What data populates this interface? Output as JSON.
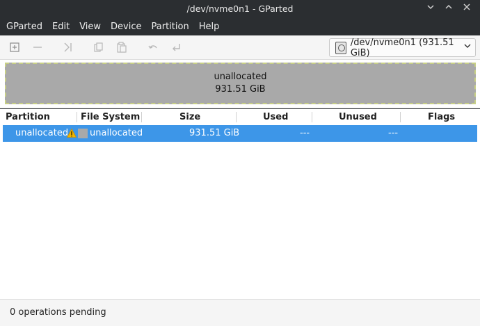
{
  "window": {
    "title": "/dev/nvme0n1 - GParted",
    "minimize": "⌄",
    "maximize": "⌃",
    "close": "✕"
  },
  "menu": [
    "GParted",
    "Edit",
    "View",
    "Device",
    "Partition",
    "Help"
  ],
  "toolbar": {
    "icons": [
      "new-icon",
      "delete-icon",
      "resize-move-icon",
      "copy-icon",
      "paste-icon",
      "undo-icon",
      "apply-icon"
    ],
    "device": "/dev/nvme0n1 (931.51 GiB)"
  },
  "map": {
    "label": "unallocated",
    "size": "931.51 GiB"
  },
  "table": {
    "columns": [
      "Partition",
      "File System",
      "Size",
      "Used",
      "Unused",
      "Flags"
    ],
    "rows": [
      {
        "partition": "unallocated",
        "filesystem": "unallocated",
        "size": "931.51 GiB",
        "used": "---",
        "unused": "---",
        "flags": ""
      }
    ]
  },
  "status": {
    "text": "0 operations pending"
  },
  "colors": {
    "selection": "#3d96e8",
    "unallocated": "#a9a9a9",
    "warning": "#f0b400"
  }
}
